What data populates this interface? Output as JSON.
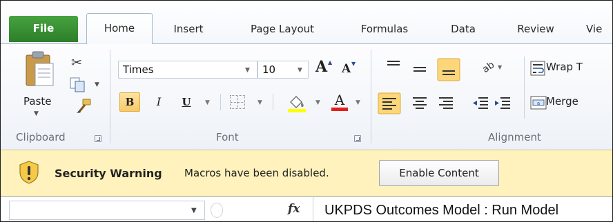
{
  "tabs": {
    "file": "File",
    "home": "Home",
    "insert": "Insert",
    "page_layout": "Page Layout",
    "formulas": "Formulas",
    "data": "Data",
    "review": "Review",
    "view": "Vie"
  },
  "clipboard": {
    "paste_label": "Paste",
    "group_label": "Clipboard"
  },
  "font": {
    "font_name": "Times",
    "font_size": "10",
    "bold_label": "B",
    "italic_label": "I",
    "underline_label": "U",
    "grow_label": "A",
    "shrink_label": "A",
    "group_label": "Font",
    "fill_color": "#ffff00",
    "font_color": "#e02020"
  },
  "alignment": {
    "wrap_text_label": "Wrap T",
    "merge_label": "Merge",
    "group_label": "Alignment"
  },
  "security": {
    "title": "Security Warning",
    "message": "Macros have been disabled.",
    "button_label": "Enable Content"
  },
  "formula_bar": {
    "name_box_value": "",
    "fx_label": "fx",
    "formula_value": "UKPDS Outcomes Model : Run Model"
  },
  "colors": {
    "file_tab": "#2d7f2a",
    "security_bar": "#fff2bc",
    "bold_active": "#f8c96a"
  }
}
